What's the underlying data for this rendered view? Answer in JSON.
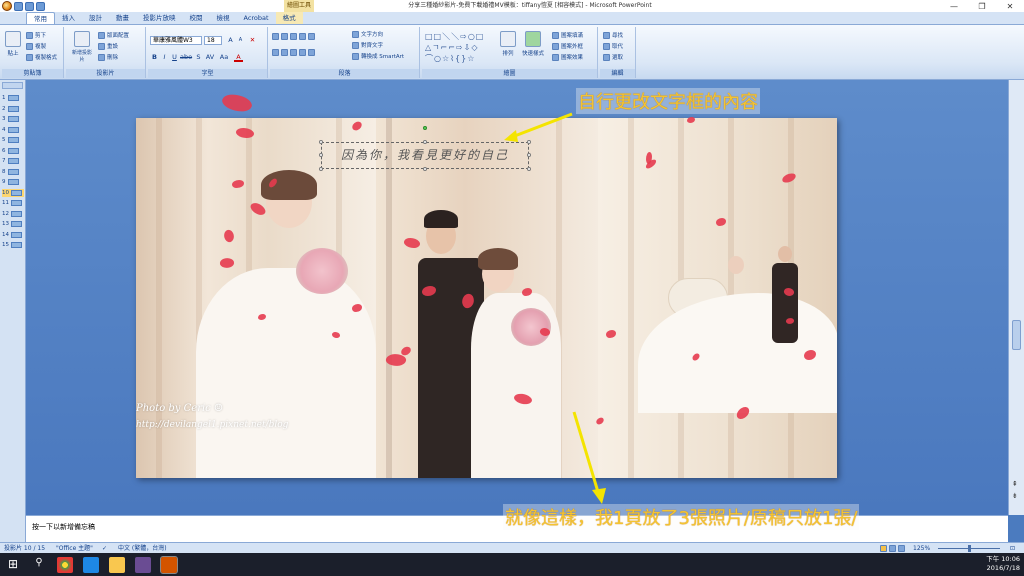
{
  "window": {
    "title": "分享三種婚紗影片-免費下載婚禮MV模板：tiffany愷夏 [相容模式] - Microsoft PowerPoint",
    "context_tab": "繪圖工具",
    "controls": [
      "—",
      "❐",
      "✕"
    ]
  },
  "tabs": [
    "常用",
    "插入",
    "設計",
    "動畫",
    "投影片放映",
    "校閱",
    "檢視",
    "Acrobat",
    "格式"
  ],
  "active_tab": "常用",
  "ribbon": {
    "clipboard": {
      "label": "剪貼簿",
      "paste": "貼上",
      "cut": "剪下",
      "copy": "複製",
      "format_painter": "複製格式"
    },
    "slides": {
      "label": "投影片",
      "new_slide": "新增投影片",
      "layout": "版面配置",
      "reset": "重設",
      "delete": "刪除"
    },
    "font": {
      "label": "字型",
      "font_name": "華康雅風體W3",
      "font_size": "18",
      "bold": "B",
      "italic": "I",
      "underline": "U",
      "strike": "abe",
      "shadow": "S",
      "spacing": "AV",
      "case": "Aa",
      "grow": "A",
      "shrink": "A",
      "color": "A"
    },
    "paragraph": {
      "label": "段落",
      "text_direction": "文字方向",
      "align_text": "對齊文字",
      "smartart": "轉換成 SmartArt"
    },
    "drawing": {
      "label": "繪圖",
      "arrange": "排列",
      "quick_styles": "快速樣式",
      "shape_fill": "圖案填滿",
      "shape_outline": "圖案外框",
      "shape_effects": "圖案效果"
    },
    "editing": {
      "label": "編輯",
      "find": "尋找",
      "replace": "取代",
      "select": "選取"
    }
  },
  "slides_pane": {
    "numbers": [
      "1",
      "2",
      "3",
      "4",
      "5",
      "6",
      "7",
      "8",
      "9",
      "10",
      "11",
      "12",
      "13",
      "14",
      "15"
    ],
    "selected": "10"
  },
  "slide": {
    "textbox_text": "因為你，我看見更好的自己",
    "watermark_line1": "Photo by Ceric ☺",
    "watermark_line2": "http://devilangel1.pixnet.net/blog"
  },
  "annotations": {
    "top": "自行更改文字框的內容",
    "bottom": "就像這樣，我1頁放了3張照片/原稿只放1張/"
  },
  "notes": {
    "placeholder": "按一下以新增備忘稿"
  },
  "status": {
    "slide_info": "投影片 10 / 15",
    "theme": "\"Office 主題\"",
    "language": "中文 (繁體，台灣)",
    "zoom": "125%"
  },
  "taskbar": {
    "time": "下午 10:06",
    "date": "2016/7/18"
  },
  "colors": {
    "accent": "#15428b",
    "ribbon_bg": "#dbe7f6",
    "canvas": "#4b7bbf",
    "annotation": "#f4c430",
    "petal": "#e63b4f"
  }
}
